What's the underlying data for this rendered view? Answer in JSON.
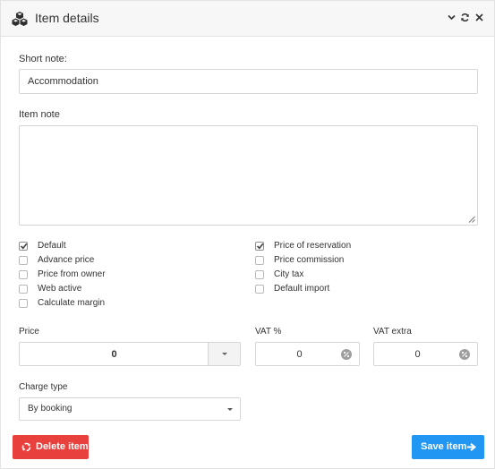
{
  "header": {
    "title": "Item details",
    "icons": [
      "cubes-icon",
      "chevron-down-icon",
      "refresh-icon",
      "close-icon"
    ]
  },
  "short_note": {
    "label": "Short note:",
    "value": "Accommodation"
  },
  "item_note": {
    "label": "Item note",
    "value": ""
  },
  "checkboxes_left": [
    {
      "label": "Default",
      "checked": true
    },
    {
      "label": "Advance price",
      "checked": false
    },
    {
      "label": "Price from owner",
      "checked": false
    },
    {
      "label": "Web active",
      "checked": false
    },
    {
      "label": "Calculate margin",
      "checked": false
    }
  ],
  "checkboxes_right": [
    {
      "label": "Price of reservation",
      "checked": true
    },
    {
      "label": "Price commission",
      "checked": false
    },
    {
      "label": "City tax",
      "checked": false
    },
    {
      "label": "Default import",
      "checked": false
    }
  ],
  "price": {
    "label": "Price",
    "value": "0"
  },
  "vat": {
    "label": "VAT %",
    "value": "0"
  },
  "vat_extra": {
    "label": "VAT extra",
    "value": "0"
  },
  "charge_type": {
    "label": "Charge type",
    "selected": "By booking"
  },
  "buttons": {
    "delete": "Delete item",
    "save": "Save item"
  },
  "colors": {
    "delete": "#e8413d",
    "save": "#2196f3",
    "header_bg": "#f7f7f7"
  }
}
